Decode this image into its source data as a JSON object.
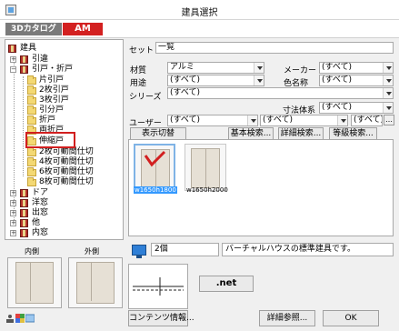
{
  "window": {
    "title": "建具選択"
  },
  "logos": {
    "catalog": "3Dカタログ",
    "am": "AM"
  },
  "tree": {
    "items": [
      {
        "label": "建具"
      },
      {
        "label": "引違"
      },
      {
        "label": "引戸・折戸"
      },
      {
        "label": "片引戸"
      },
      {
        "label": "2枚引戸"
      },
      {
        "label": "3枚引戸"
      },
      {
        "label": "引分戸"
      },
      {
        "label": "折戸"
      },
      {
        "label": "両折戸"
      },
      {
        "label": "伸縮戸"
      },
      {
        "label": "2枚可動間仕切"
      },
      {
        "label": "4枚可動間仕切"
      },
      {
        "label": "6枚可動間仕切"
      },
      {
        "label": "8枚可動間仕切"
      },
      {
        "label": "ドア"
      },
      {
        "label": "洋窓"
      },
      {
        "label": "出窓"
      },
      {
        "label": "他"
      },
      {
        "label": "内窓"
      }
    ]
  },
  "filters": {
    "set_label": "セット",
    "set_value": "一覧",
    "material_label": "材質",
    "material_value": "アルミ",
    "maker_label": "メーカー",
    "maker_value": "(すべて)",
    "use_label": "用途",
    "use_value": "(すべて)",
    "color_label": "色名称",
    "color_value": "(すべて)",
    "series_label": "シリーズ",
    "series_value": "(すべて)",
    "dimension_label": "寸法体系",
    "dimension_value": "(すべて)",
    "user_label": "ユーザー",
    "user_value1": "(すべて)",
    "user_value2": "(すべて)",
    "user_value3": "(すべて)"
  },
  "toolbar": {
    "display_switch": "表示切替",
    "basic_search": "基本検索...",
    "detail_search": "詳細検索...",
    "grade_search": "等級検索..."
  },
  "grid": {
    "items": [
      {
        "label": "w1650h1800",
        "selected": true
      },
      {
        "label": "w1650h2000",
        "selected": false
      }
    ]
  },
  "preview": {
    "inside_label": "内側",
    "outside_label": "外側"
  },
  "info": {
    "count": "2個",
    "description": "バーチャルハウスの標準建具です。",
    "net_label": ".net"
  },
  "buttons": {
    "contents_info": "コンテンツ情報...",
    "detail_ref": "詳細参照...",
    "ok": "OK"
  },
  "colors": {
    "accent_red": "#d32020",
    "selection_blue": "#3399ff"
  }
}
